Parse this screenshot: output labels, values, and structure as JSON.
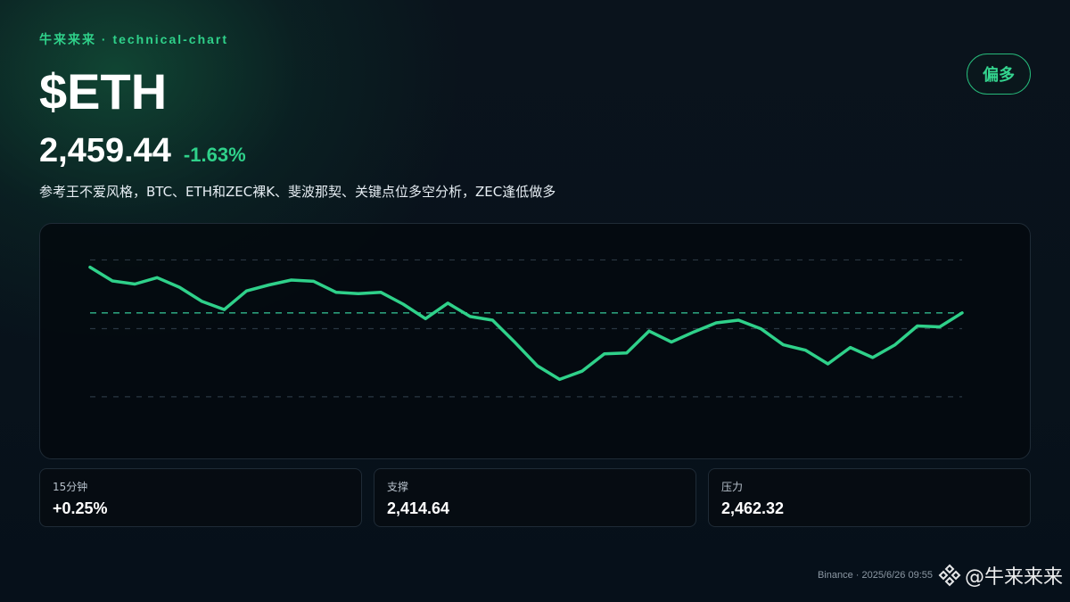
{
  "header": {
    "brand": "牛来来来 · technical-chart",
    "ticker": "$ETH",
    "bias": "偏多",
    "price": "2,459.44",
    "change": "-1.63%",
    "description": "参考王不爱风格，BTC、ETH和ZEC裸K、斐波那契、关键点位多空分析，ZEC逢低做多"
  },
  "chart_data": {
    "type": "line",
    "series": [
      {
        "values": [
          2496.0,
          2488.5,
          2486.8,
          2490.3,
          2485.0,
          2477.3,
          2472.8,
          2483.0,
          2486.3,
          2489.0,
          2488.3,
          2482.3,
          2481.5,
          2482.3,
          2475.8,
          2467.8,
          2476.3,
          2469.0,
          2467.0,
          2454.8,
          2442.0,
          2434.5,
          2439.0,
          2448.5,
          2449.0,
          2461.0,
          2455.0,
          2460.5,
          2465.5,
          2467.0,
          2462.3,
          2453.5,
          2450.5,
          2443.0,
          2452.0,
          2446.5,
          2453.5,
          2463.8,
          2463.3,
          2471.0
        ]
      }
    ],
    "reference_lines": [
      2500,
      2471.0,
      2462.32,
      2425
    ],
    "ylim": [
      2400,
      2510
    ],
    "colors": {
      "line": "#2fd18a",
      "current_level": "#2a9d7a",
      "grid": "#2a3742"
    },
    "grid": false
  },
  "stats": [
    {
      "label": "15分钟",
      "value": "+0.25%"
    },
    {
      "label": "支撑",
      "value": "2,414.64"
    },
    {
      "label": "压力",
      "value": "2,462.32"
    }
  ],
  "footer": {
    "source": "Binance · 2025/6/26 09:55",
    "watermark": "@牛来来来"
  },
  "colors": {
    "accent": "#2fd18a",
    "background": "#08121b",
    "card_border": "#1f2b36"
  },
  "icons": {
    "watermark_logo": "binance-diamond-icon"
  }
}
